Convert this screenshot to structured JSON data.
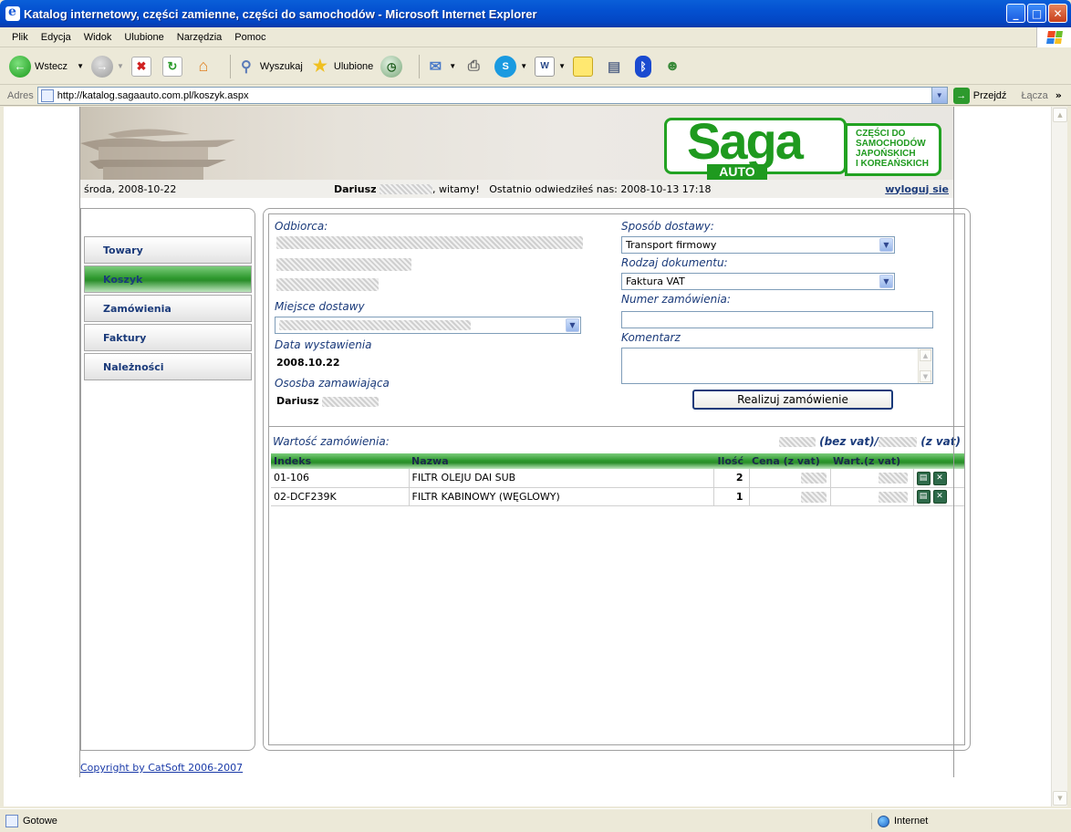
{
  "window": {
    "title": "Katalog internetowy, części zamienne, części do samochodów - Microsoft Internet Explorer"
  },
  "menu": [
    "Plik",
    "Edycja",
    "Widok",
    "Ulubione",
    "Narzędzia",
    "Pomoc"
  ],
  "toolbar": {
    "back_label": "Wstecz",
    "search_label": "Wyszukaj",
    "favorites_label": "Ulubione"
  },
  "address": {
    "label": "Adres",
    "url": "http://katalog.sagaauto.com.pl/koszyk.aspx",
    "go_label": "Przejdź",
    "links_label": "Łącza"
  },
  "status": {
    "text": "Gotowe",
    "zone": "Internet"
  },
  "logo": {
    "brand": "Saga",
    "sub": "AUTO",
    "tagline_1": "CZĘŚCI DO",
    "tagline_2": "SAMOCHODÓW",
    "tagline_3": "JAPOŃSKICH",
    "tagline_4": "I KOREAŃSKICH"
  },
  "infobar": {
    "date": "środa, 2008-10-22",
    "user_first": "Dariusz",
    "greeting": ", witamy!",
    "last_visit": "Ostatnio odwiedziłeś nas: 2008-10-13 17:18",
    "logout": "wyloguj sie"
  },
  "nav": [
    "Towary",
    "Koszyk",
    "Zamówienia",
    "Faktury",
    "Należności"
  ],
  "form": {
    "recipient_label": "Odbiorca:",
    "delivery_place_label": "Miejsce dostawy",
    "issue_date_label": "Data wystawienia",
    "issue_date": "2008.10.22",
    "orderer_label": "Ososba zamawiająca",
    "orderer_first": "Dariusz",
    "delivery_method_label": "Sposób dostawy:",
    "delivery_method": "Transport firmowy",
    "doc_type_label": "Rodzaj dokumentu:",
    "doc_type": "Faktura VAT",
    "order_number_label": "Numer zamówienia:",
    "comment_label": "Komentarz",
    "submit_label": "Realizuj zamówienie"
  },
  "summary": {
    "label": "Wartość zamówienia:",
    "net_suffix": "(bez vat)/",
    "gross_suffix": "(z vat)"
  },
  "table": {
    "headers": [
      "Indeks",
      "Nazwa",
      "Ilość",
      "Cena (z vat)",
      "Wart.(z vat)"
    ],
    "rows": [
      {
        "index": "01-106",
        "name": "FILTR OLEJU DAI SUB",
        "qty": "2"
      },
      {
        "index": "02-DCF239K",
        "name": "FILTR KABINOWY (WĘGLOWY)",
        "qty": "1"
      }
    ]
  },
  "footer": {
    "copyright": "Copyright by CatSoft 2006-2007"
  }
}
